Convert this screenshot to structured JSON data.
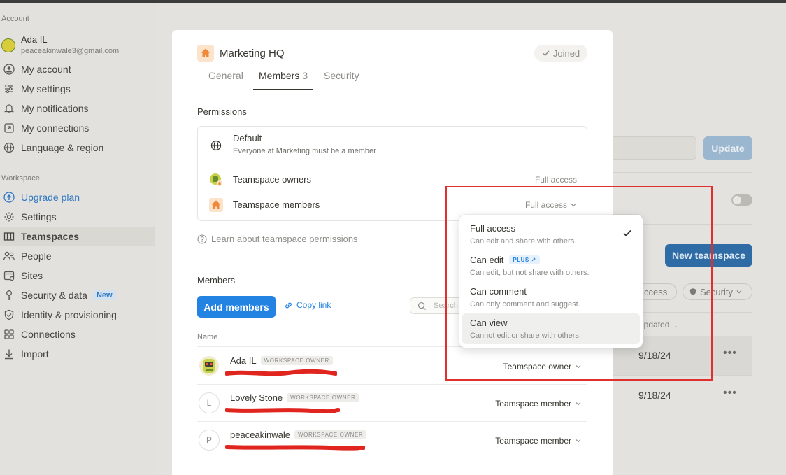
{
  "sidebar": {
    "account_label": "Account",
    "user": {
      "name": "Ada IL",
      "email": "peaceakinwale3@gmail.com"
    },
    "account_items": [
      {
        "label": "My account",
        "icon": "user-circle-icon"
      },
      {
        "label": "My settings",
        "icon": "sliders-icon"
      },
      {
        "label": "My notifications",
        "icon": "bell-icon"
      },
      {
        "label": "My connections",
        "icon": "external-link-icon"
      },
      {
        "label": "Language & region",
        "icon": "globe-icon"
      }
    ],
    "workspace_label": "Workspace",
    "workspace_items": [
      {
        "label": "Upgrade plan",
        "icon": "upgrade-icon"
      },
      {
        "label": "Settings",
        "icon": "gear-icon"
      },
      {
        "label": "Teamspaces",
        "icon": "teamspaces-icon"
      },
      {
        "label": "People",
        "icon": "people-icon"
      },
      {
        "label": "Sites",
        "icon": "sites-icon"
      },
      {
        "label": "Security & data",
        "icon": "key-icon",
        "badge": "New"
      },
      {
        "label": "Identity & provisioning",
        "icon": "shield-icon"
      },
      {
        "label": "Connections",
        "icon": "grid-icon"
      },
      {
        "label": "Import",
        "icon": "download-icon"
      }
    ]
  },
  "background": {
    "update_button": "Update",
    "new_teamspace_button": "New teamspace",
    "filter_access": "ccess",
    "filter_security": "Security",
    "updated_header": "Updated",
    "rows": [
      {
        "date": "9/18/24"
      },
      {
        "date": "9/18/24"
      }
    ]
  },
  "modal": {
    "title": "Marketing HQ",
    "joined_label": "Joined",
    "tabs": [
      {
        "label": "General"
      },
      {
        "label": "Members",
        "count": "3"
      },
      {
        "label": "Security"
      }
    ],
    "permissions": {
      "heading": "Permissions",
      "default_title": "Default",
      "default_sub": "Everyone at Marketing must be a member",
      "owners_label": "Teamspace owners",
      "owners_access": "Full access",
      "members_label": "Teamspace members",
      "members_access": "Full access"
    },
    "learn_link": "Learn about teamspace permissions",
    "members": {
      "heading": "Members",
      "add_button": "Add members",
      "copy_link": "Copy link",
      "search_placeholder": "Search",
      "col_name": "Name",
      "owner_badge": "WORKSPACE OWNER",
      "rows": [
        {
          "name": "Ada IL",
          "initial": "",
          "role": "Teamspace owner"
        },
        {
          "name": "Lovely Stone",
          "initial": "L",
          "role": "Teamspace member"
        },
        {
          "name": "peaceakinwale",
          "initial": "P",
          "role": "Teamspace member"
        }
      ]
    }
  },
  "menu": {
    "selected": "Full access",
    "items": [
      {
        "label": "Full access",
        "desc": "Can edit and share with others."
      },
      {
        "label": "Can edit",
        "desc": "Can edit, but not share with others.",
        "badge": "PLUS"
      },
      {
        "label": "Can comment",
        "desc": "Can only comment and suggest."
      },
      {
        "label": "Can view",
        "desc": "Cannot edit or share with others."
      }
    ]
  },
  "colors": {
    "accent": "#2383e2",
    "annotation": "#e0302d",
    "teamspace_icon": "#f0883a"
  }
}
